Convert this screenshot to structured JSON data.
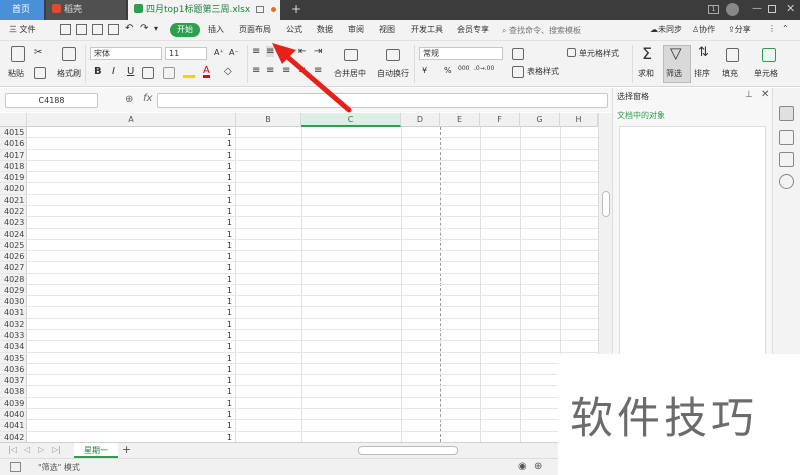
{
  "tabs": {
    "home": "首页",
    "straw": "稻壳",
    "file": "四月top1标题第三周.xlsx"
  },
  "menu": {
    "file": "三 文件",
    "start": "开始",
    "items": [
      "插入",
      "页面布局",
      "公式",
      "数据",
      "审阅",
      "视图",
      "开发工具",
      "会员专享"
    ],
    "search_placeholder": "查找命令、搜索模板",
    "sync": "未同步",
    "collab": "协作",
    "share": "分享"
  },
  "ribbon": {
    "paste": "粘贴",
    "format_painter": "格式刷",
    "font": "宋体",
    "size": "11",
    "number_format": "常规",
    "merge": "合并居中",
    "wrap": "自动换行",
    "cell_style": "单元格样式",
    "table_style": "表格样式",
    "sum": "求和",
    "filter": "筛选",
    "sort": "排序",
    "fill": "填充",
    "cells": "单元格",
    "bold": "B",
    "italic": "I",
    "underline": "U",
    "currency": "¥",
    "percent": "%",
    "grow": "A⁺",
    "shrink": "A⁻"
  },
  "formula": {
    "namebox": "C4188",
    "fx": "fx"
  },
  "columns": [
    "A",
    "B",
    "C",
    "D",
    "E",
    "F",
    "G",
    "H"
  ],
  "rows": [
    {
      "n": "4015",
      "v": "1"
    },
    {
      "n": "4016",
      "v": "1"
    },
    {
      "n": "4017",
      "v": "1"
    },
    {
      "n": "4018",
      "v": "1"
    },
    {
      "n": "4019",
      "v": "1"
    },
    {
      "n": "4020",
      "v": "1"
    },
    {
      "n": "4021",
      "v": "1"
    },
    {
      "n": "4022",
      "v": "1"
    },
    {
      "n": "4023",
      "v": "1"
    },
    {
      "n": "4024",
      "v": "1"
    },
    {
      "n": "4025",
      "v": "1"
    },
    {
      "n": "4026",
      "v": "1"
    },
    {
      "n": "4027",
      "v": "1"
    },
    {
      "n": "4028",
      "v": "1"
    },
    {
      "n": "4029",
      "v": "1"
    },
    {
      "n": "4030",
      "v": "1"
    },
    {
      "n": "4031",
      "v": "1"
    },
    {
      "n": "4032",
      "v": "1"
    },
    {
      "n": "4033",
      "v": "1"
    },
    {
      "n": "4034",
      "v": "1"
    },
    {
      "n": "4035",
      "v": "1"
    },
    {
      "n": "4036",
      "v": "1"
    },
    {
      "n": "4037",
      "v": "1"
    },
    {
      "n": "4038",
      "v": "1"
    },
    {
      "n": "4039",
      "v": "1"
    },
    {
      "n": "4040",
      "v": "1"
    },
    {
      "n": "4041",
      "v": "1"
    },
    {
      "n": "4042",
      "v": "1"
    }
  ],
  "sheet": {
    "name": "星期一",
    "add": "+"
  },
  "status": {
    "mode": "\"筛选\" 模式"
  },
  "pane": {
    "title": "选择窗格",
    "objects": "文档中的对象"
  },
  "watermark": "软件技巧",
  "colors": {
    "accent": "#2e9e4f",
    "arrow": "#e8201a"
  }
}
